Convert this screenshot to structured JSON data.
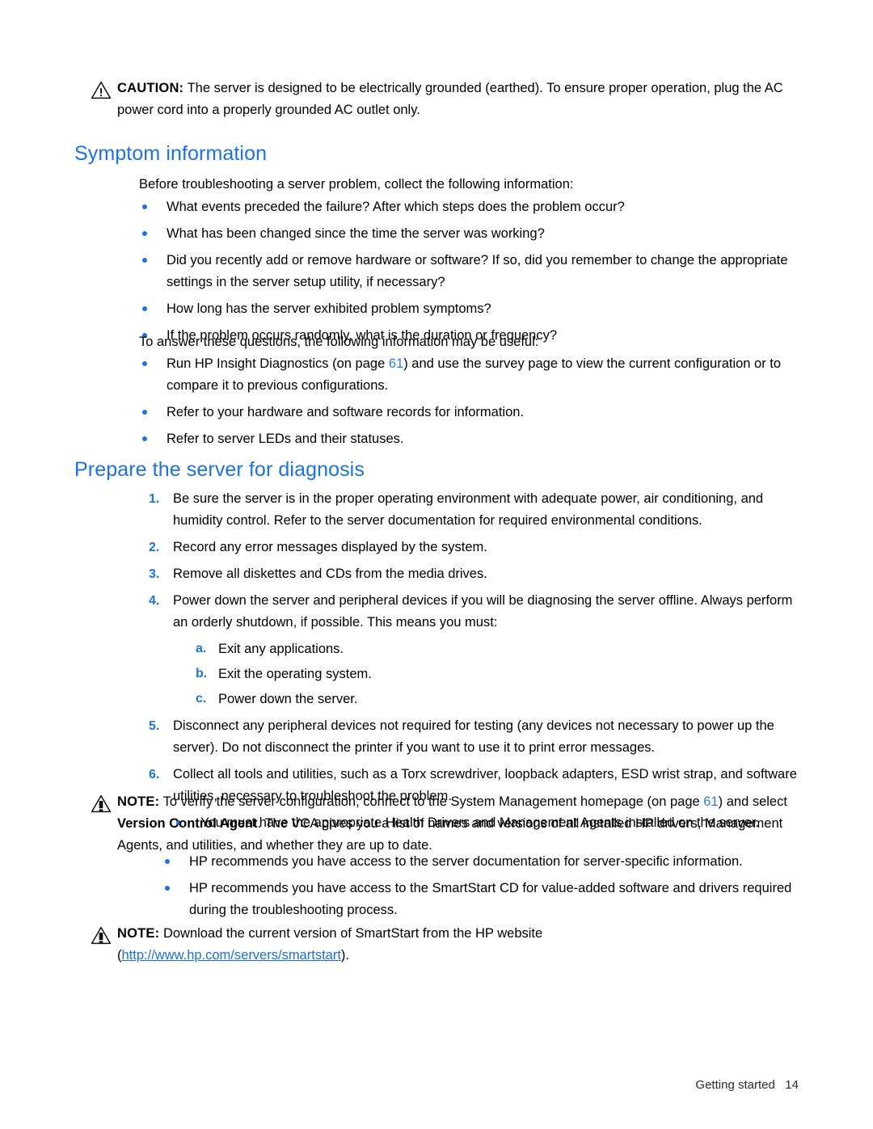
{
  "document": {
    "page_number": "14",
    "footer_section": "Getting started",
    "footer_text": "Getting started   14"
  },
  "colors": {
    "heading_blue": "#1a72e8",
    "link_blue": "#2a7fe0",
    "bullet_blue": "#1a72e8",
    "marker_blue": "#1a72e8",
    "body_text": "#1a1a1a"
  },
  "caution": {
    "icon": "warning-triangle-outline-icon",
    "label": "CAUTION:",
    "text": "The server is designed to be electrically grounded (earthed). To ensure proper operation, plug the AC power cord into a properly grounded AC outlet only."
  },
  "symptom_section": {
    "heading": "Symptom information",
    "intro": "Before troubleshooting a server problem, collect the following information:",
    "bullets": [
      "What events preceded the failure? After which steps does the problem occur?",
      "What has been changed since the time the server was working?",
      "Did you recently add or remove hardware or software? If so, did you remember to change the appropriate settings in the server setup utility, if necessary?",
      "How long has the server exhibited problem symptoms?",
      "If the problem occurs randomly, what is the duration or frequency?"
    ],
    "answer_intro": "To answer these questions, the following information may be useful:",
    "answer_bullets": [
      {
        "prefix": "Run HP Insight Diagnostics (on page ",
        "link": "61",
        "suffix": ") and use the survey page to view the current configuration or to compare it to previous configurations."
      },
      {
        "prefix": "Refer to your hardware and software records for information.",
        "link": "",
        "suffix": ""
      },
      {
        "prefix": "Refer to server LEDs and their statuses.",
        "link": "",
        "suffix": ""
      }
    ]
  },
  "prepare_section": {
    "heading": "Prepare the server for diagnosis",
    "steps": [
      {
        "marker": "1.",
        "text": "Be sure the server is in the proper operating environment with adequate power, air conditioning, and humidity control. Refer to the server documentation for required environmental conditions."
      },
      {
        "marker": "2.",
        "text": "Record any error messages displayed by the system."
      },
      {
        "marker": "3.",
        "text": "Remove all diskettes and CDs from the media drives."
      },
      {
        "marker": "4.",
        "text": "Power down the server and peripheral devices if you will be diagnosing the server offline. Always perform an orderly shutdown, if possible. This means you must:"
      },
      {
        "marker": "5.",
        "text": "Disconnect any peripheral devices not required for testing (any devices not necessary to power up the server). Do not disconnect the printer if you want to use it to print error messages."
      },
      {
        "marker": "6.",
        "text": "Collect all tools and utilities, such as a Torx screwdriver, loopback adapters, ESD wrist strap, and software utilities, necessary to troubleshoot the problem."
      }
    ],
    "substeps": [
      {
        "marker": "a.",
        "text": "Exit any applications."
      },
      {
        "marker": "b.",
        "text": "Exit the operating system."
      },
      {
        "marker": "c.",
        "text": "Power down the server."
      }
    ],
    "step6_bullet": "You must have the appropriate Health Drivers and Management Agents installed on the server."
  },
  "note1": {
    "icon": "note-triangle-filled-icon",
    "label": "NOTE:",
    "text_part1": "To verify the server configuration, connect to the System Management homepage (on page ",
    "link": "61",
    "text_part2": ") and select ",
    "bold_term": "Version Control Agent",
    "text_part3": ". The VCA gives you a list of names and versions of all installed HP drivers, Management Agents, and utilities, and whether they are up to date.",
    "bullets": [
      "HP recommends you have access to the server documentation for server-specific information.",
      "HP recommends you have access to the SmartStart CD for value-added software and drivers required during the troubleshooting process."
    ]
  },
  "note2": {
    "icon": "note-triangle-filled-icon",
    "label": "NOTE:",
    "text_part1": "Download the current version of SmartStart from the HP website",
    "open_paren": "(",
    "url": "http://www.hp.com/servers/smartstart",
    "close_paren": ")."
  }
}
